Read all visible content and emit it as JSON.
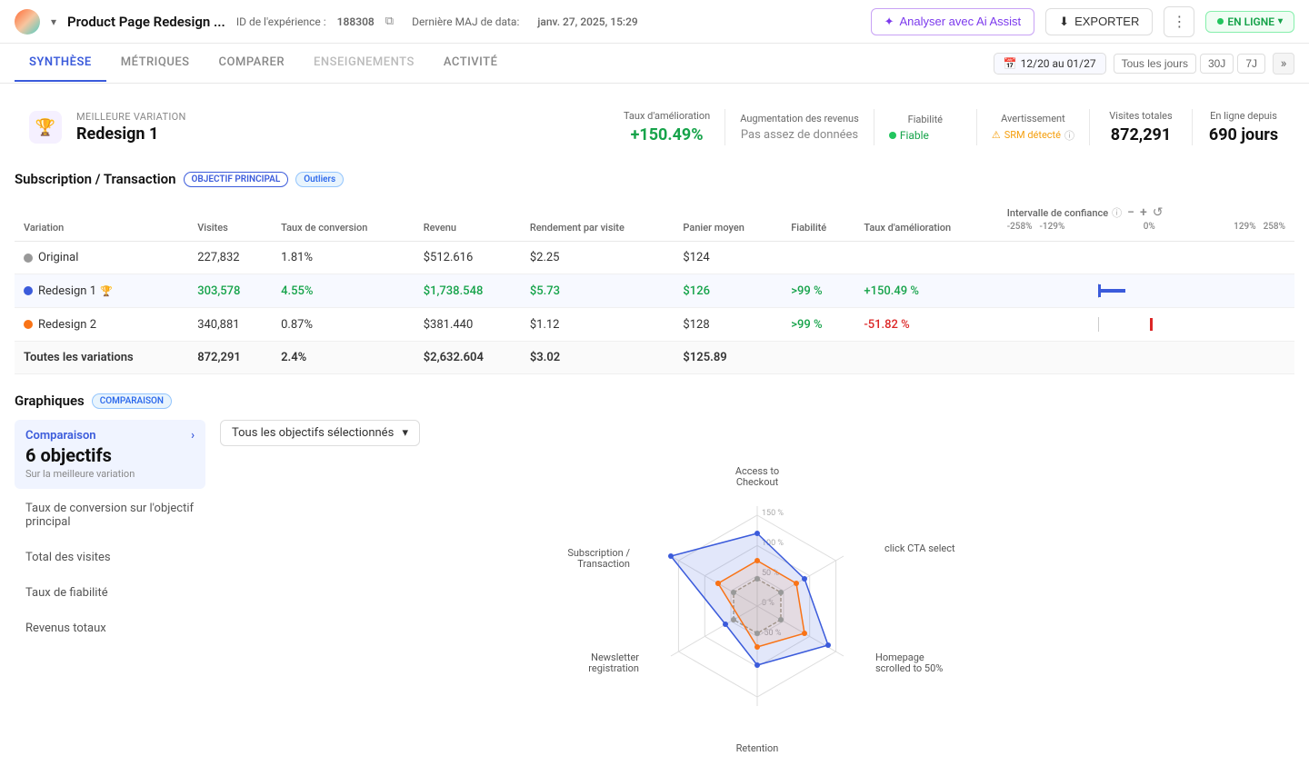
{
  "header": {
    "title": "Product Page Redesign ...",
    "id_label": "ID de l'expérience :",
    "id_value": "188308",
    "date_label": "Dernière MAJ de data:",
    "date_value": "janv. 27, 2025, 15:29",
    "ai_button": "Analyser avec Ai Assist",
    "export_button": "EXPORTER",
    "status": "EN LIGNE"
  },
  "tabs": {
    "items": [
      {
        "id": "synthese",
        "label": "SYNTHÈSE",
        "active": true
      },
      {
        "id": "metriques",
        "label": "MÉTRIQUES",
        "active": false
      },
      {
        "id": "comparer",
        "label": "COMPARER",
        "active": false
      },
      {
        "id": "enseignements",
        "label": "ENSEIGNEMENTS",
        "active": false
      },
      {
        "id": "activite",
        "label": "ACTIVITÉ",
        "active": false
      }
    ],
    "date_filter": "12/20 au 01/27",
    "filter_tous": "Tous les jours",
    "filter_30j": "30J",
    "filter_7j": "7J"
  },
  "best_variation": {
    "label": "Meilleure variation",
    "name": "Redesign 1",
    "taux_label": "Taux d'amélioration",
    "taux_value": "+150.49%",
    "revenus_label": "Augmentation des revenus",
    "revenus_value": "Pas assez de données",
    "fiabilite_label": "Fiabilité",
    "fiabilite_value": "Fiable",
    "avertissement_label": "Avertissement",
    "avertissement_value": "SRM détecté",
    "visites_label": "Visites totales",
    "visites_value": "872,291",
    "enligne_label": "En ligne depuis",
    "enligne_value": "690 jours"
  },
  "table": {
    "section_title": "Subscription / Transaction",
    "badge_primary": "OBJECTIF PRINCIPAL",
    "badge_outliers": "Outliers",
    "columns": [
      "Variation",
      "Visites",
      "Taux de conversion",
      "Revenu",
      "Rendement par visite",
      "Panier moyen",
      "Fiabilité",
      "Taux d'amélioration",
      "Intervalle de confiance"
    ],
    "ci_scale": [
      "-258%",
      "-129%",
      "0%",
      "129%",
      "258%"
    ],
    "rows": [
      {
        "name": "Original",
        "dot": "gray",
        "visites": "227,832",
        "taux_conv": "1.81%",
        "revenu": "$512.616",
        "rendement": "$2.25",
        "panier": "$124",
        "fiabilite": "",
        "taux_amelio": "",
        "has_trophy": false
      },
      {
        "name": "Redesign 1",
        "dot": "blue",
        "visites": "303,578",
        "taux_conv": "4.55%",
        "revenu": "$1,738.548",
        "rendement": "$5.73",
        "panier": "$126",
        "fiabilite": ">99 %",
        "taux_amelio": "+150.49 %",
        "has_trophy": true,
        "is_best": true
      },
      {
        "name": "Redesign 2",
        "dot": "orange",
        "visites": "340,881",
        "taux_conv": "0.87%",
        "revenu": "$381.440",
        "rendement": "$1.12",
        "panier": "$128",
        "fiabilite": ">99 %",
        "taux_amelio": "-51.82 %",
        "has_trophy": false,
        "is_worst": true
      },
      {
        "name": "Toutes les variations",
        "dot": null,
        "visites": "872,291",
        "taux_conv": "2.4%",
        "revenu": "$2,632.604",
        "rendement": "$3.02",
        "panier": "$125.89",
        "fiabilite": "",
        "taux_amelio": "",
        "is_total": true
      }
    ]
  },
  "charts": {
    "section_title": "Graphiques",
    "badge": "COMPARAISON",
    "dropdown_label": "Tous les objectifs sélectionnés",
    "sidebar_items": [
      {
        "id": "comparaison",
        "label": "Comparaison",
        "count": "6 objectifs",
        "sub": "Sur la meilleure variation",
        "active": true
      },
      {
        "id": "taux-conv",
        "label": "Taux de conversion sur l'objectif principal",
        "active": false
      },
      {
        "id": "total-visites",
        "label": "Total des visites",
        "active": false
      },
      {
        "id": "taux-fiabilite",
        "label": "Taux de fiabilité",
        "active": false
      },
      {
        "id": "revenus",
        "label": "Revenus totaux",
        "active": false
      }
    ],
    "radar": {
      "labels": [
        "Access to Checkout",
        "click CTA select",
        "Homepage scrolled to 50%",
        "Retention",
        "Newsletter registration",
        "Subscription / Transaction"
      ],
      "scale_labels": [
        "150 %",
        "100 %",
        "50 %",
        "0 %",
        "-50 %"
      ],
      "series": [
        {
          "name": "Redesign 1",
          "color": "#3b5bdb"
        },
        {
          "name": "Original",
          "color": "#999"
        },
        {
          "name": "Redesign 2",
          "color": "#f97316"
        }
      ]
    }
  }
}
